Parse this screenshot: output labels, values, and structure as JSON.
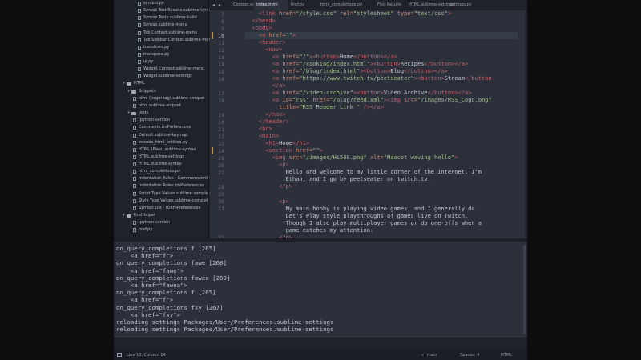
{
  "sidebar": {
    "items": [
      {
        "label": "symbol.py",
        "kind": "file"
      },
      {
        "label": "Syntax Test Results.sublime-syntax",
        "kind": "file"
      },
      {
        "label": "Syntax Tests.sublime-build",
        "kind": "file"
      },
      {
        "label": "Syntax.sublime-menu",
        "kind": "file"
      },
      {
        "label": "Tab Context.sublime-menu",
        "kind": "file"
      },
      {
        "label": "Tab Sidebar Context.sublime-menu",
        "kind": "file"
      },
      {
        "label": "transform.py",
        "kind": "file"
      },
      {
        "label": "transpose.py",
        "kind": "file"
      },
      {
        "label": "ui.py",
        "kind": "file"
      },
      {
        "label": "Widget Context.sublime-menu",
        "kind": "file"
      },
      {
        "label": "Widget.sublime-settings",
        "kind": "file"
      },
      {
        "label": "HTML",
        "kind": "folder"
      },
      {
        "label": "Snippets",
        "kind": "folder"
      },
      {
        "label": "html (begin tag).sublime-snippet",
        "kind": "file"
      },
      {
        "label": "html.sublime-snippet",
        "kind": "file"
      },
      {
        "label": "tests",
        "kind": "folder"
      },
      {
        "label": ".python-version",
        "kind": "file"
      },
      {
        "label": "Comments.tmPreferences",
        "kind": "file"
      },
      {
        "label": "Default.sublime-keymap",
        "kind": "file"
      },
      {
        "label": "encode_html_entities.py",
        "kind": "file"
      },
      {
        "label": "HTML (Plain).sublime-syntax",
        "kind": "file"
      },
      {
        "label": "HTML.sublime-settings",
        "kind": "file"
      },
      {
        "label": "HTML.sublime-syntax",
        "kind": "file"
      },
      {
        "label": "html_completions.py",
        "kind": "file"
      },
      {
        "label": "Indentation Rules - Comments.tmPr",
        "kind": "file"
      },
      {
        "label": "Indentation Rules.tmPreferences",
        "kind": "file"
      },
      {
        "label": "Script Type Values.sublime-complet",
        "kind": "file"
      },
      {
        "label": "Style Type Values.sublime-completi",
        "kind": "file"
      },
      {
        "label": "Symbol List - ID.tmPreferences",
        "kind": "file"
      },
      {
        "label": "HrefHelper",
        "kind": "folder"
      },
      {
        "label": ".python-version",
        "kind": "file"
      },
      {
        "label": "href.py",
        "kind": "file"
      }
    ]
  },
  "tabs": [
    {
      "label": "Context.sub",
      "active": false
    },
    {
      "label": "index.html",
      "active": true
    },
    {
      "label": "href.py",
      "active": false
    },
    {
      "label": "html_completions.py",
      "active": false
    },
    {
      "label": "Find Results",
      "active": false
    },
    {
      "label": "HTML.sublime-settings",
      "active": false
    },
    {
      "label": "settings.py",
      "active": false
    }
  ],
  "tab_nav": {
    "prev": "◂",
    "next": "▸"
  },
  "editor": {
    "line_numbers": [
      "7",
      "8",
      "9",
      "10",
      "11",
      "12",
      "13",
      "14",
      "15",
      "16",
      "",
      "17",
      "18",
      "",
      "19",
      "20",
      "21",
      "22",
      "23",
      "24",
      "25",
      "26",
      "27",
      "",
      "28",
      "29",
      "30",
      "31",
      "",
      "",
      "",
      "32"
    ],
    "active_line": "10",
    "lines": [
      [
        [
          "t-txt",
          "    "
        ],
        [
          "t-tag",
          "<link "
        ],
        [
          "t-attr",
          "href="
        ],
        [
          "t-str",
          "\"/style.css\" "
        ],
        [
          "t-attr",
          "rel="
        ],
        [
          "t-str",
          "\"stylesheet\" "
        ],
        [
          "t-attr",
          "type="
        ],
        [
          "t-str",
          "\"text/css\""
        ],
        [
          "t-tag",
          ">"
        ]
      ],
      [
        [
          "t-txt",
          "  "
        ],
        [
          "t-tag",
          "</head>"
        ]
      ],
      [
        [
          "t-txt",
          "  "
        ],
        [
          "t-tag",
          "<body>"
        ]
      ],
      [
        [
          "t-txt",
          "    "
        ],
        [
          "t-tag",
          "<a "
        ],
        [
          "t-attr",
          "href="
        ],
        [
          "t-str",
          "\"\""
        ],
        [
          "t-tag",
          ">"
        ]
      ],
      [
        [
          "t-txt",
          "    "
        ],
        [
          "t-tag",
          "<header>"
        ]
      ],
      [
        [
          "t-txt",
          "      "
        ],
        [
          "t-tag",
          "<nav>"
        ]
      ],
      [
        [
          "t-txt",
          "        "
        ],
        [
          "t-tag",
          "<a "
        ],
        [
          "t-attr",
          "href="
        ],
        [
          "t-str",
          "\"/\""
        ],
        [
          "t-tag",
          "><button>"
        ],
        [
          "t-txt",
          "Home"
        ],
        [
          "t-tag",
          "</button></a>"
        ]
      ],
      [
        [
          "t-txt",
          "        "
        ],
        [
          "t-tag",
          "<a "
        ],
        [
          "t-attr",
          "href="
        ],
        [
          "t-str",
          "\"/cooking/index.html\""
        ],
        [
          "t-tag",
          "><button>"
        ],
        [
          "t-txt",
          "Recipes"
        ],
        [
          "t-tag",
          "</button></a>"
        ]
      ],
      [
        [
          "t-txt",
          "        "
        ],
        [
          "t-tag",
          "<a "
        ],
        [
          "t-attr",
          "href="
        ],
        [
          "t-str",
          "\"/blog/index.html\""
        ],
        [
          "t-tag",
          "><button>"
        ],
        [
          "t-txt",
          "Blog"
        ],
        [
          "t-tag",
          "</button></a>"
        ]
      ],
      [
        [
          "t-txt",
          "        "
        ],
        [
          "t-tag",
          "<a "
        ],
        [
          "t-attr",
          "href="
        ],
        [
          "t-str",
          "\"https://www.twitch.tv/peetseater\""
        ],
        [
          "t-tag",
          "><button>"
        ],
        [
          "t-txt",
          "Stream"
        ],
        [
          "t-tag",
          "</button"
        ]
      ],
      [
        [
          "t-txt",
          "        "
        ],
        [
          "t-tag",
          "</a>"
        ]
      ],
      [
        [
          "t-txt",
          "        "
        ],
        [
          "t-tag",
          "<a "
        ],
        [
          "t-attr",
          "href="
        ],
        [
          "t-str",
          "\"/video-archive\""
        ],
        [
          "t-tag",
          "><button>"
        ],
        [
          "t-txt",
          "Video Archive"
        ],
        [
          "t-tag",
          "</button></a>"
        ]
      ],
      [
        [
          "t-txt",
          "        "
        ],
        [
          "t-tag",
          "<a "
        ],
        [
          "t-attr",
          "id="
        ],
        [
          "t-str",
          "\"rss\" "
        ],
        [
          "t-attr",
          "href="
        ],
        [
          "t-str",
          "\"/blag/feed.xml\""
        ],
        [
          "t-tag",
          "><img "
        ],
        [
          "t-attr",
          "src="
        ],
        [
          "t-str",
          "\"/images/RSS_Logo.png\""
        ]
      ],
      [
        [
          "t-txt",
          "          "
        ],
        [
          "t-attr",
          "title="
        ],
        [
          "t-str",
          "\"RSS Reader Link \""
        ],
        [
          "t-tag",
          " /></a>"
        ]
      ],
      [
        [
          "t-txt",
          "      "
        ],
        [
          "t-tag",
          "</nav>"
        ]
      ],
      [
        [
          "t-txt",
          "    "
        ],
        [
          "t-tag",
          "</header>"
        ]
      ],
      [
        [
          "t-txt",
          "    "
        ],
        [
          "t-tag",
          "<br>"
        ]
      ],
      [
        [
          "t-txt",
          "    "
        ],
        [
          "t-tag",
          "<main>"
        ]
      ],
      [
        [
          "t-txt",
          "      "
        ],
        [
          "t-tag",
          "<h1>"
        ],
        [
          "t-txt",
          "Home"
        ],
        [
          "t-tag",
          "</h1>"
        ]
      ],
      [
        [
          "t-txt",
          "      "
        ],
        [
          "t-tag",
          "<section "
        ],
        [
          "t-attr",
          "href="
        ],
        [
          "t-str",
          "\"\""
        ],
        [
          "t-tag",
          ">"
        ]
      ],
      [
        [
          "t-txt",
          "        "
        ],
        [
          "t-tag",
          "<img "
        ],
        [
          "t-attr",
          "src="
        ],
        [
          "t-str",
          "\"/images/Hi500.png\" "
        ],
        [
          "t-attr",
          "alt="
        ],
        [
          "t-str",
          "\"Mascot waving hello\""
        ],
        [
          "t-tag",
          ">"
        ]
      ],
      [
        [
          "t-txt",
          "          "
        ],
        [
          "t-tag",
          "<p>"
        ]
      ],
      [
        [
          "t-txt",
          "            Hello and welcome to my little corner of the internet. I'm"
        ]
      ],
      [
        [
          "t-txt",
          "            Ethan, and I go by peetseater on twitch.tv."
        ]
      ],
      [
        [
          "t-txt",
          "          "
        ],
        [
          "t-tag",
          "</p>"
        ]
      ],
      [
        [
          "t-txt",
          ""
        ]
      ],
      [
        [
          "t-txt",
          "          "
        ],
        [
          "t-tag",
          "<p>"
        ]
      ],
      [
        [
          "t-txt",
          "            My main hobby is playing video games, and I generally do"
        ]
      ],
      [
        [
          "t-txt",
          "            Let's Play style playthroughs of games live on Twitch."
        ]
      ],
      [
        [
          "t-txt",
          "            Though I also play multiplayer games or do one-offs when a"
        ]
      ],
      [
        [
          "t-txt",
          "            game catches my attention."
        ]
      ],
      [
        [
          "t-txt",
          "          "
        ],
        [
          "t-tag",
          "</p>"
        ]
      ]
    ]
  },
  "console": {
    "lines": [
      "on_query_completions f [265]",
      "    <a href=\"f\">",
      "on_query_completions fawe [268]",
      "    <a href=\"fawe\">",
      "on_query_completions fawea [269]",
      "    <a href=\"fawea\">",
      "on_query_completions f [265]",
      "    <a href=\"f\">",
      "on_query_completions fxy [267]",
      "    <a href=\"fxy\">",
      "reloading settings Packages/User/Preferences.sublime-settings",
      "reloading settings Packages/User/Preferences.sublime-settings"
    ]
  },
  "statusbar": {
    "position": "Line 10, Column 14",
    "branch": "main",
    "branch_count": "",
    "spaces": "Spaces: 4",
    "syntax": "HTML"
  },
  "colors": {
    "editor_bg": "#2b303b",
    "sidebar_bg": "#1f2229",
    "tag": "#bf616a",
    "attr": "#d08770",
    "string": "#a3be8c",
    "modified_marker": "#c79b4e"
  }
}
